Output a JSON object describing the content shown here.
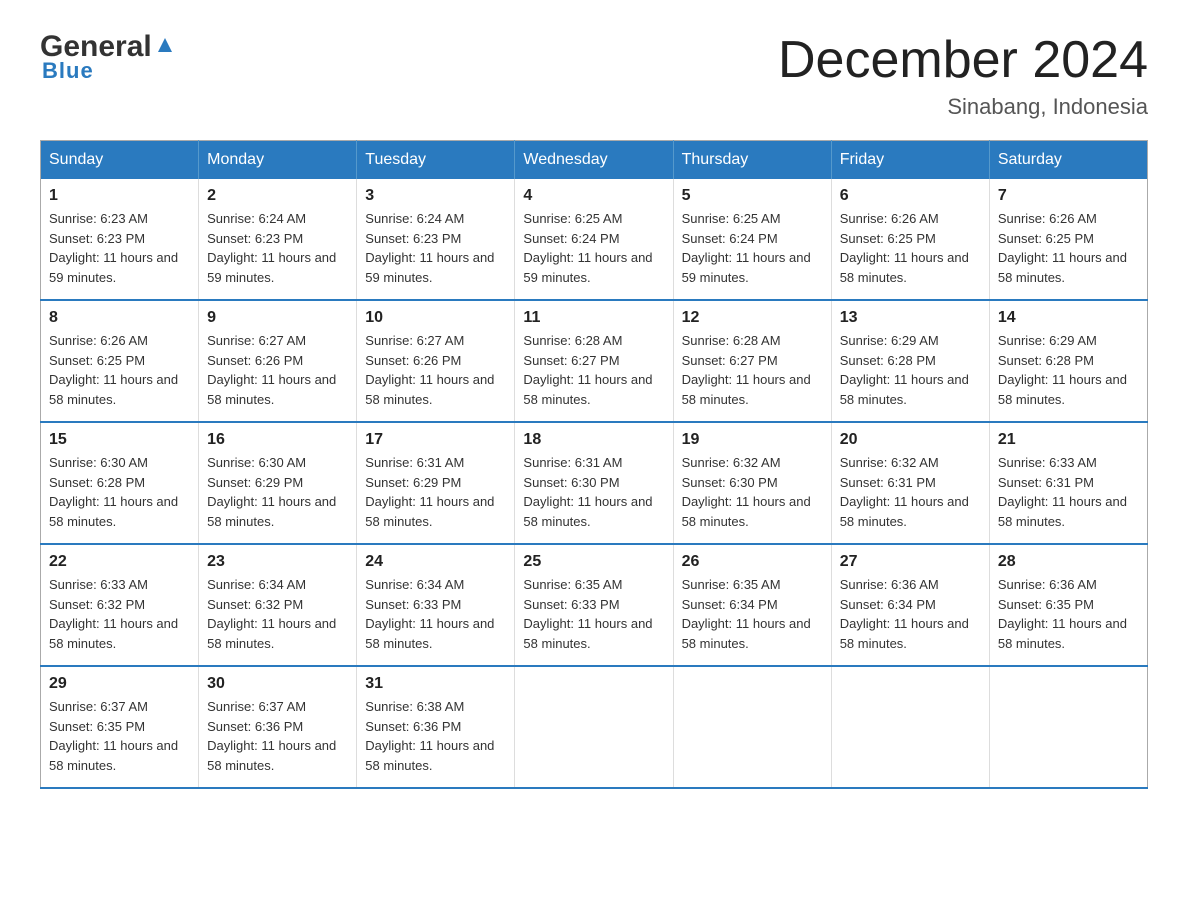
{
  "logo": {
    "general": "General",
    "blue": "Blue"
  },
  "title": "December 2024",
  "location": "Sinabang, Indonesia",
  "days_of_week": [
    "Sunday",
    "Monday",
    "Tuesday",
    "Wednesday",
    "Thursday",
    "Friday",
    "Saturday"
  ],
  "weeks": [
    [
      {
        "day": "1",
        "sunrise": "6:23 AM",
        "sunset": "6:23 PM",
        "daylight": "11 hours and 59 minutes."
      },
      {
        "day": "2",
        "sunrise": "6:24 AM",
        "sunset": "6:23 PM",
        "daylight": "11 hours and 59 minutes."
      },
      {
        "day": "3",
        "sunrise": "6:24 AM",
        "sunset": "6:23 PM",
        "daylight": "11 hours and 59 minutes."
      },
      {
        "day": "4",
        "sunrise": "6:25 AM",
        "sunset": "6:24 PM",
        "daylight": "11 hours and 59 minutes."
      },
      {
        "day": "5",
        "sunrise": "6:25 AM",
        "sunset": "6:24 PM",
        "daylight": "11 hours and 59 minutes."
      },
      {
        "day": "6",
        "sunrise": "6:26 AM",
        "sunset": "6:25 PM",
        "daylight": "11 hours and 58 minutes."
      },
      {
        "day": "7",
        "sunrise": "6:26 AM",
        "sunset": "6:25 PM",
        "daylight": "11 hours and 58 minutes."
      }
    ],
    [
      {
        "day": "8",
        "sunrise": "6:26 AM",
        "sunset": "6:25 PM",
        "daylight": "11 hours and 58 minutes."
      },
      {
        "day": "9",
        "sunrise": "6:27 AM",
        "sunset": "6:26 PM",
        "daylight": "11 hours and 58 minutes."
      },
      {
        "day": "10",
        "sunrise": "6:27 AM",
        "sunset": "6:26 PM",
        "daylight": "11 hours and 58 minutes."
      },
      {
        "day": "11",
        "sunrise": "6:28 AM",
        "sunset": "6:27 PM",
        "daylight": "11 hours and 58 minutes."
      },
      {
        "day": "12",
        "sunrise": "6:28 AM",
        "sunset": "6:27 PM",
        "daylight": "11 hours and 58 minutes."
      },
      {
        "day": "13",
        "sunrise": "6:29 AM",
        "sunset": "6:28 PM",
        "daylight": "11 hours and 58 minutes."
      },
      {
        "day": "14",
        "sunrise": "6:29 AM",
        "sunset": "6:28 PM",
        "daylight": "11 hours and 58 minutes."
      }
    ],
    [
      {
        "day": "15",
        "sunrise": "6:30 AM",
        "sunset": "6:28 PM",
        "daylight": "11 hours and 58 minutes."
      },
      {
        "day": "16",
        "sunrise": "6:30 AM",
        "sunset": "6:29 PM",
        "daylight": "11 hours and 58 minutes."
      },
      {
        "day": "17",
        "sunrise": "6:31 AM",
        "sunset": "6:29 PM",
        "daylight": "11 hours and 58 minutes."
      },
      {
        "day": "18",
        "sunrise": "6:31 AM",
        "sunset": "6:30 PM",
        "daylight": "11 hours and 58 minutes."
      },
      {
        "day": "19",
        "sunrise": "6:32 AM",
        "sunset": "6:30 PM",
        "daylight": "11 hours and 58 minutes."
      },
      {
        "day": "20",
        "sunrise": "6:32 AM",
        "sunset": "6:31 PM",
        "daylight": "11 hours and 58 minutes."
      },
      {
        "day": "21",
        "sunrise": "6:33 AM",
        "sunset": "6:31 PM",
        "daylight": "11 hours and 58 minutes."
      }
    ],
    [
      {
        "day": "22",
        "sunrise": "6:33 AM",
        "sunset": "6:32 PM",
        "daylight": "11 hours and 58 minutes."
      },
      {
        "day": "23",
        "sunrise": "6:34 AM",
        "sunset": "6:32 PM",
        "daylight": "11 hours and 58 minutes."
      },
      {
        "day": "24",
        "sunrise": "6:34 AM",
        "sunset": "6:33 PM",
        "daylight": "11 hours and 58 minutes."
      },
      {
        "day": "25",
        "sunrise": "6:35 AM",
        "sunset": "6:33 PM",
        "daylight": "11 hours and 58 minutes."
      },
      {
        "day": "26",
        "sunrise": "6:35 AM",
        "sunset": "6:34 PM",
        "daylight": "11 hours and 58 minutes."
      },
      {
        "day": "27",
        "sunrise": "6:36 AM",
        "sunset": "6:34 PM",
        "daylight": "11 hours and 58 minutes."
      },
      {
        "day": "28",
        "sunrise": "6:36 AM",
        "sunset": "6:35 PM",
        "daylight": "11 hours and 58 minutes."
      }
    ],
    [
      {
        "day": "29",
        "sunrise": "6:37 AM",
        "sunset": "6:35 PM",
        "daylight": "11 hours and 58 minutes."
      },
      {
        "day": "30",
        "sunrise": "6:37 AM",
        "sunset": "6:36 PM",
        "daylight": "11 hours and 58 minutes."
      },
      {
        "day": "31",
        "sunrise": "6:38 AM",
        "sunset": "6:36 PM",
        "daylight": "11 hours and 58 minutes."
      },
      null,
      null,
      null,
      null
    ]
  ],
  "labels": {
    "sunrise_prefix": "Sunrise: ",
    "sunset_prefix": "Sunset: ",
    "daylight_prefix": "Daylight: "
  }
}
